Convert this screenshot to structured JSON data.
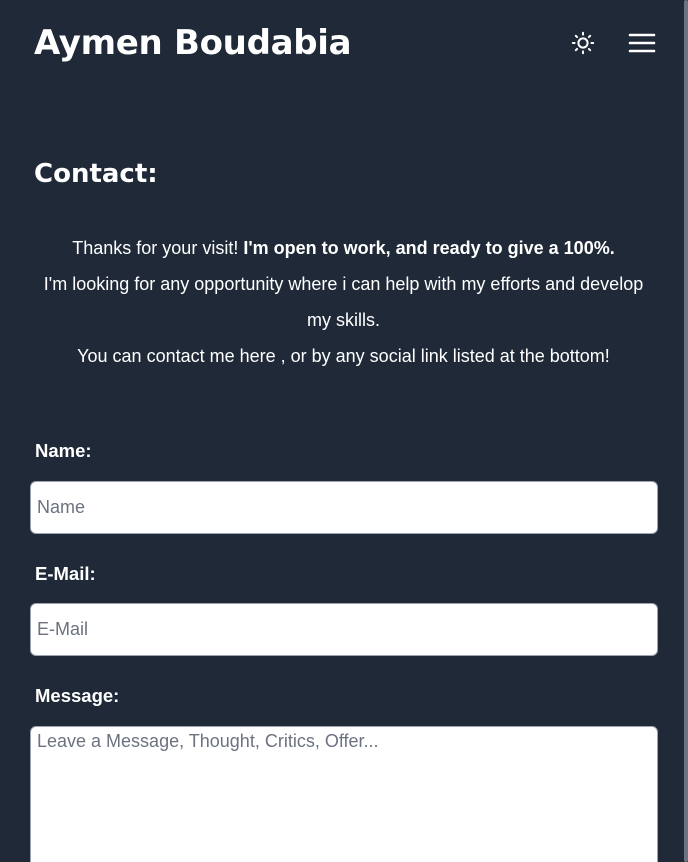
{
  "header": {
    "site_title": "Aymen Boudabia",
    "theme_toggle_icon": "sun-icon",
    "menu_icon": "hamburger-menu-icon"
  },
  "contact": {
    "title": "Contact:",
    "intro": {
      "line1_plain": "Thanks for your visit! ",
      "line1_bold": "I'm open to work, and ready to give a 100%.",
      "line2": "I'm looking for any opportunity where i can help with my efforts and develop my skills.",
      "line3": "You can contact me here , or by any social link listed at the bottom!"
    }
  },
  "form": {
    "name_label": "Name:",
    "name_placeholder": "Name",
    "email_label": "E-Mail:",
    "email_placeholder": "E-Mail",
    "message_label": "Message:",
    "message_placeholder": "Leave a Message, Thought, Critics, Offer..."
  },
  "colors": {
    "background": "#1f2937",
    "text": "#ffffff",
    "input_background": "#ffffff"
  }
}
